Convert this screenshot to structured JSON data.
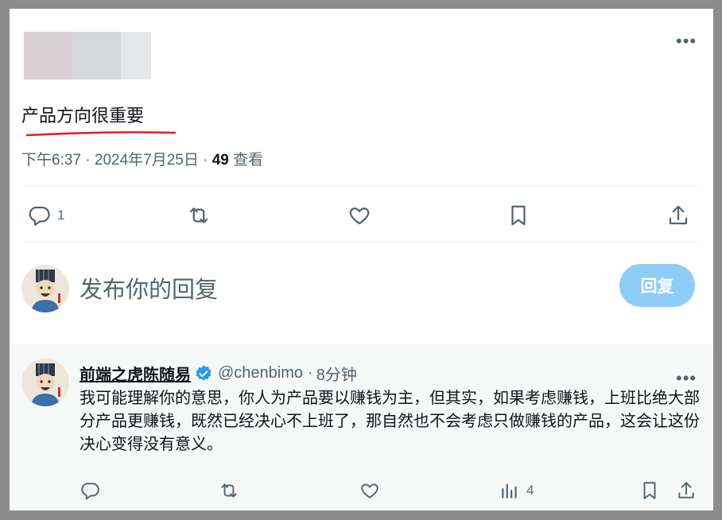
{
  "tweet": {
    "text": "产品方向很重要",
    "time": "下午6:37",
    "date": "2024年7月25日",
    "separator": "·",
    "views_count": "49",
    "views_label": "查看",
    "more_label": "•••",
    "actions": {
      "reply_count": "1",
      "retweet_count": "",
      "like_count": ""
    }
  },
  "compose": {
    "placeholder": "发布你的回复",
    "reply_button": "回复"
  },
  "reply": {
    "author_name": "前端之虎陈随易",
    "handle": "@chenbimo",
    "time": "8分钟",
    "separator": "·",
    "text": "我可能理解你的意思，你人为产品要以赚钱为主，但其实，如果考虑赚钱，上班比绝大部分产品更赚钱，既然已经决心不上班了，那自然也不会考虑只做赚钱的产品，这会让这份决心变得没有意义。",
    "views_count": "4",
    "more_label": "•••"
  },
  "colors": {
    "accent": "#1d9bf0",
    "reply_button_bg": "#8ecdf7",
    "muted": "#536471",
    "annotation": "#e0201d"
  }
}
